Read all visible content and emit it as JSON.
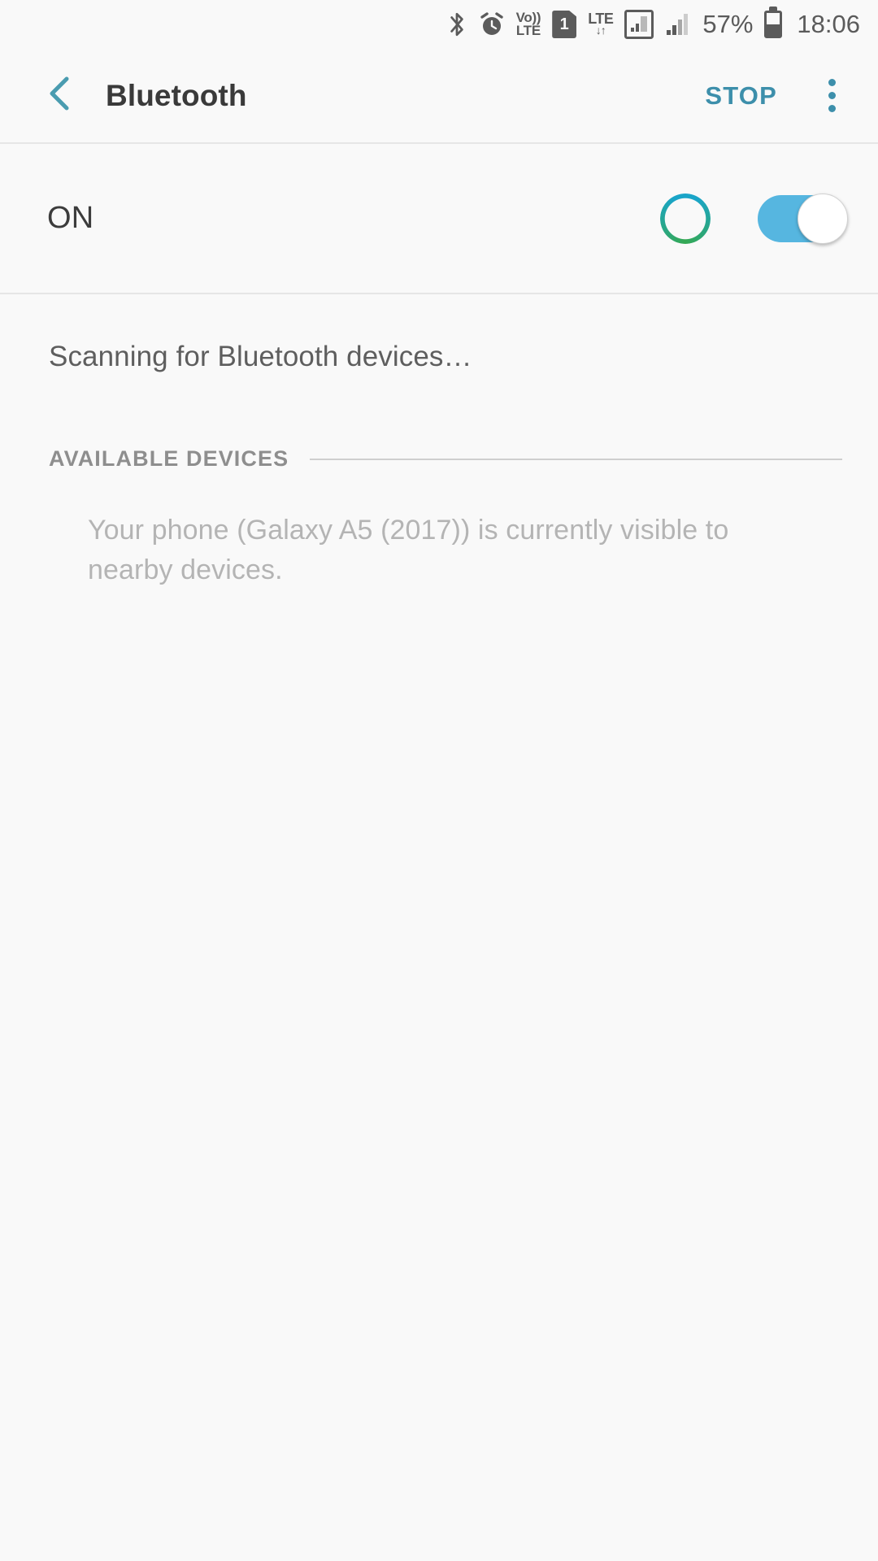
{
  "status_bar": {
    "icons": [
      {
        "name": "bluetooth-icon",
        "label": "Bluetooth"
      },
      {
        "name": "alarm-icon",
        "label": "Alarm"
      },
      {
        "name": "volte-icon",
        "line1": "Vo))",
        "line2": "LTE"
      },
      {
        "name": "sim-card-icon",
        "label": "1"
      },
      {
        "name": "lte-data-icon",
        "lte": "LTE",
        "arrows": "↓↑"
      },
      {
        "name": "signal-sim1-icon",
        "label": "Signal 1"
      },
      {
        "name": "signal-sim2-icon",
        "label": "Signal 2"
      }
    ],
    "battery_percent": "57%",
    "battery_level": 50,
    "time": "18:06"
  },
  "app_bar": {
    "back_label": "Back",
    "title": "Bluetooth",
    "stop_label": "STOP",
    "overflow_label": "More options"
  },
  "toggle_row": {
    "state_label": "ON",
    "toggle_on": true,
    "spinner_label": "Scanning in progress"
  },
  "main": {
    "scanning_text": "Scanning for Bluetooth devices…",
    "section_title": "AVAILABLE DEVICES",
    "empty_note": "Your phone (Galaxy A5 (2017)) is currently visible to nearby devices."
  },
  "colors": {
    "accent": "#3d8fab",
    "toggle_on": "#56b6e0",
    "spinner_blue": "#1aa5c8",
    "spinner_green": "#35a853",
    "background": "#f9f9f9",
    "divider": "#e6e6e6",
    "text_primary": "#3a3a3a",
    "text_secondary": "#5e5e5e",
    "text_muted": "#b4b4b4"
  }
}
